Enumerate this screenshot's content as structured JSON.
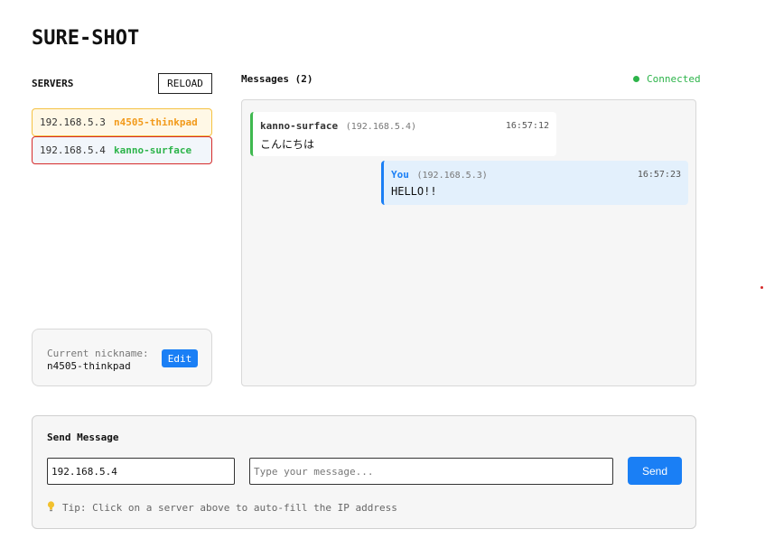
{
  "app": {
    "title": "SURE-SHOT"
  },
  "servers": {
    "title": "SERVERS",
    "reload_label": "RELOAD",
    "items": [
      {
        "ip": "192.168.5.3",
        "name": "n4505-thinkpad"
      },
      {
        "ip": "192.168.5.4",
        "name": "kanno-surface"
      }
    ]
  },
  "nickname": {
    "label": "Current nickname:",
    "value": "n4505-thinkpad",
    "edit_label": "Edit"
  },
  "messages": {
    "title": "Messages (2)",
    "status": "Connected",
    "items": [
      {
        "sender": "kanno-surface",
        "ip": "(192.168.5.4)",
        "time": "16:57:12",
        "text": "こんにちは"
      },
      {
        "sender": "You",
        "ip": "(192.168.5.3)",
        "time": "16:57:23",
        "text": "HELLO!!"
      }
    ]
  },
  "send": {
    "title": "Send Message",
    "ip_value": "192.168.5.4",
    "message_placeholder": "Type your message...",
    "send_label": "Send",
    "tip": "Tip: Click on a server above to auto-fill the IP address"
  },
  "colors": {
    "accent": "#1a7ff5",
    "connected": "#2db44a",
    "server_1_name": "#f29a1a",
    "server_2_name": "#2db44a"
  }
}
